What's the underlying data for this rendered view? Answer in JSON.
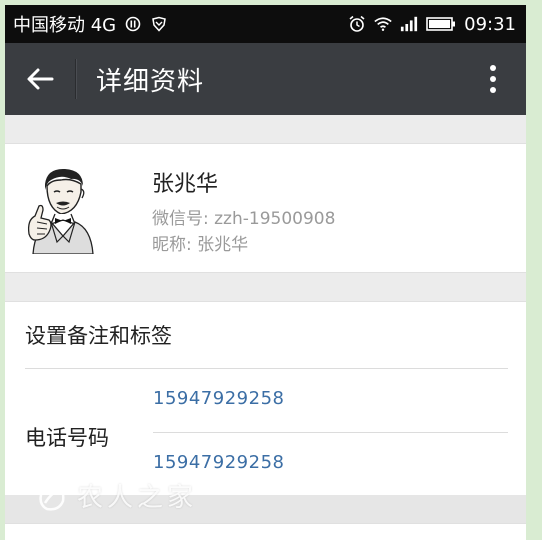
{
  "status_bar": {
    "carrier": "中国移动 4G",
    "time": "09:31"
  },
  "app_bar": {
    "title": "详细资料"
  },
  "profile": {
    "name": "张兆华",
    "wechat_id": "微信号: zzh-19500908",
    "nickname": "昵称: 张兆华"
  },
  "details": {
    "remark_label": "设置备注和标签",
    "phone_label": "电话号码",
    "phones": [
      "15947929258",
      "15947929258"
    ]
  },
  "watermark": {
    "text": "农人之家"
  },
  "colors": {
    "status_bar": "#0d0d0d",
    "app_bar": "#3a3d41",
    "link": "#3b6ea5",
    "background": "#ececec"
  }
}
